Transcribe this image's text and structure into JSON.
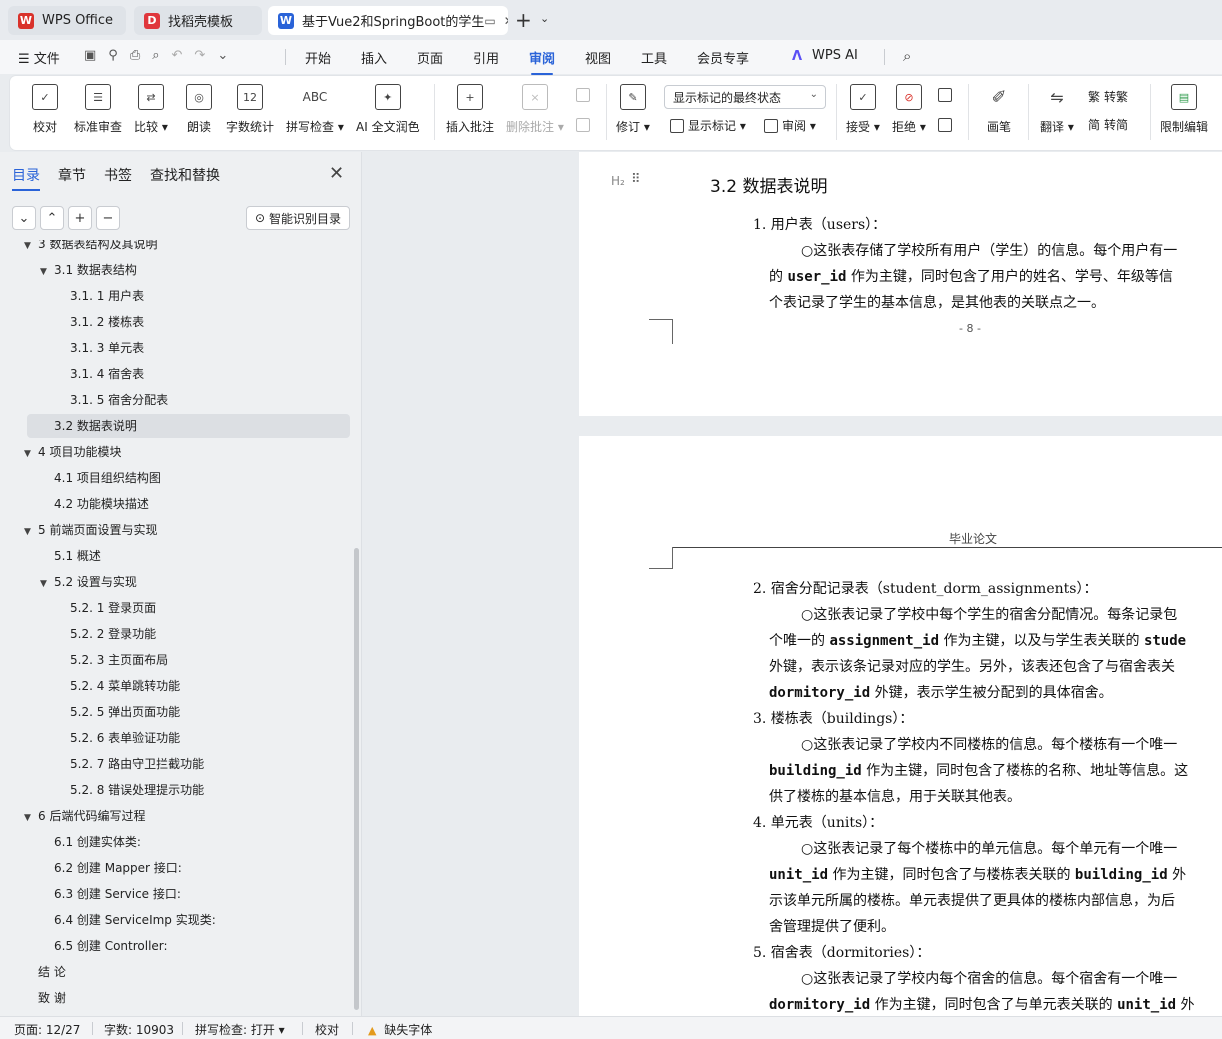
{
  "tabs": [
    {
      "label": "WPS Office",
      "icon": "wps-logo-icon",
      "color": "#d9322b"
    },
    {
      "label": "找稻壳模板",
      "icon": "docer-icon",
      "color": "#e0373d"
    },
    {
      "label": "基于Vue2和SpringBoot的学生",
      "icon": "word-doc-icon",
      "color": "#2a63d8"
    }
  ],
  "menubar": {
    "file": "文件",
    "items": [
      "开始",
      "插入",
      "页面",
      "引用",
      "审阅",
      "视图",
      "工具",
      "会员专享",
      "WPS AI"
    ],
    "active": "审阅"
  },
  "ribbon": {
    "buttons": [
      {
        "label": "校对"
      },
      {
        "label": "标准审查"
      },
      {
        "label": "比较 ▾"
      },
      {
        "label": "朗读"
      },
      {
        "label": "字数统计"
      },
      {
        "label": "拼写检查 ▾"
      },
      {
        "label": "AI 全文润色"
      },
      {
        "label": "插入批注"
      },
      {
        "label": "删除批注 ▾"
      },
      {
        "label": "修订 ▾"
      },
      {
        "label": "接受 ▾"
      },
      {
        "label": "拒绝 ▾"
      },
      {
        "label": "画笔"
      },
      {
        "label": "翻译 ▾"
      },
      {
        "label": "限制编辑"
      }
    ],
    "icon_text": {
      "wordcount": "12",
      "spell": "ABC"
    },
    "markup_select": "显示标记的最终状态",
    "show_markup": "显示标记 ▾",
    "review_pane": "审阅 ▾",
    "to_traditional": "转繁",
    "to_simplified": "转简"
  },
  "nav": {
    "tabs": [
      "目录",
      "章节",
      "书签",
      "查找和替换"
    ],
    "active_tab": "目录",
    "smart_button": "智能识别目录",
    "toc": [
      {
        "label": "3   数据表结构及其说明",
        "level": 0,
        "tri": "▼"
      },
      {
        "label": "3.1   数据表结构",
        "level": 1,
        "tri": "▼"
      },
      {
        "label": "3.1. 1   用户表",
        "level": 2,
        "tri": ""
      },
      {
        "label": "3.1. 2   楼栋表",
        "level": 2,
        "tri": ""
      },
      {
        "label": "3.1. 3   单元表",
        "level": 2,
        "tri": ""
      },
      {
        "label": "3.1. 4   宿舍表",
        "level": 2,
        "tri": ""
      },
      {
        "label": "3.1. 5   宿舍分配表",
        "level": 2,
        "tri": ""
      },
      {
        "label": "3.2   数据表说明",
        "level": 1,
        "tri": "",
        "selected": true
      },
      {
        "label": "4   项目功能模块",
        "level": 0,
        "tri": "▼"
      },
      {
        "label": "4.1   项目组织结构图",
        "level": 1,
        "tri": ""
      },
      {
        "label": "4.2   功能模块描述",
        "level": 1,
        "tri": ""
      },
      {
        "label": "5   前端页面设置与实现",
        "level": 0,
        "tri": "▼"
      },
      {
        "label": "5.1   概述",
        "level": 1,
        "tri": ""
      },
      {
        "label": "5.2   设置与实现",
        "level": 1,
        "tri": "▼"
      },
      {
        "label": "5.2. 1   登录页面",
        "level": 2,
        "tri": ""
      },
      {
        "label": "5.2. 2   登录功能",
        "level": 2,
        "tri": ""
      },
      {
        "label": "5.2. 3   主页面布局",
        "level": 2,
        "tri": ""
      },
      {
        "label": "5.2. 4   菜单跳转功能",
        "level": 2,
        "tri": ""
      },
      {
        "label": "5.2. 5   弹出页面功能",
        "level": 2,
        "tri": ""
      },
      {
        "label": "5.2. 6   表单验证功能",
        "level": 2,
        "tri": ""
      },
      {
        "label": "5.2. 7   路由守卫拦截功能",
        "level": 2,
        "tri": ""
      },
      {
        "label": "5.2. 8   错误处理提示功能",
        "level": 2,
        "tri": ""
      },
      {
        "label": "6   后端代码编写过程",
        "level": 0,
        "tri": "▼"
      },
      {
        "label": "6.1   创建实体类:",
        "level": 1,
        "tri": ""
      },
      {
        "label": "6.2   创建 Mapper 接口:",
        "level": 1,
        "tri": ""
      },
      {
        "label": "6.3   创建 Service 接口:",
        "level": 1,
        "tri": ""
      },
      {
        "label": "6.4   创建 ServiceImp 实现类:",
        "level": 1,
        "tri": ""
      },
      {
        "label": "6.5   创建 Controller:",
        "level": 1,
        "tri": ""
      },
      {
        "label": "结    论",
        "level": 0,
        "tri": ""
      },
      {
        "label": "致    谢",
        "level": 0,
        "tri": ""
      }
    ]
  },
  "document": {
    "heading_marker": "H₂",
    "heading": "3.2   数据表说明",
    "page_number": "- 8 -",
    "header_text": "毕业论文",
    "lines_p1": [
      "1.   用户表（users）：",
      "○这张表存储了学校所有用户（学生）的信息。每个用户有一",
      "的 §user_id§ 作为主键，同时包含了用户的姓名、学号、年级等信",
      "个表记录了学生的基本信息，是其他表的关联点之一。"
    ],
    "lines_p2": [
      "2.   宿舍分配记录表（student_dorm_assignments）：",
      "○这张表记录了学校中每个学生的宿舍分配情况。每条记录包",
      "个唯一的 §assignment_id§ 作为主键，以及与学生表关联的 §stude",
      "外键，表示该条记录对应的学生。另外，该表还包含了与宿舍表关",
      "§dormitory_id§ 外键，表示学生被分配到的具体宿舍。",
      "3.   楼栋表（buildings）：",
      "○这张表记录了学校内不同楼栋的信息。每个楼栋有一个唯一",
      "§building_id§ 作为主键，同时包含了楼栋的名称、地址等信息。这",
      "供了楼栋的基本信息，用于关联其他表。",
      "4.   单元表（units）：",
      "○这张表记录了每个楼栋中的单元信息。每个单元有一个唯一",
      "§unit_id§ 作为主键，同时包含了与楼栋表关联的 §building_id§ 外",
      "示该单元所属的楼栋。单元表提供了更具体的楼栋内部信息，为后",
      "舍管理提供了便利。",
      "5.   宿舍表（dormitories）：",
      "○这张表记录了学校内每个宿舍的信息。每个宿舍有一个唯一",
      "§dormitory_id§ 作为主键，同时包含了与单元表关联的 §unit_id§ 外",
      "示该宿舍所属的单元。宿舍表记录了宿舍的基本信息，如宿舍号"
    ]
  },
  "status": {
    "page": "页面: 12/27",
    "words": "字数: 10903",
    "spell": "拼写检查: 打开 ▾",
    "proof": "校对",
    "missing_font": "缺失字体"
  }
}
